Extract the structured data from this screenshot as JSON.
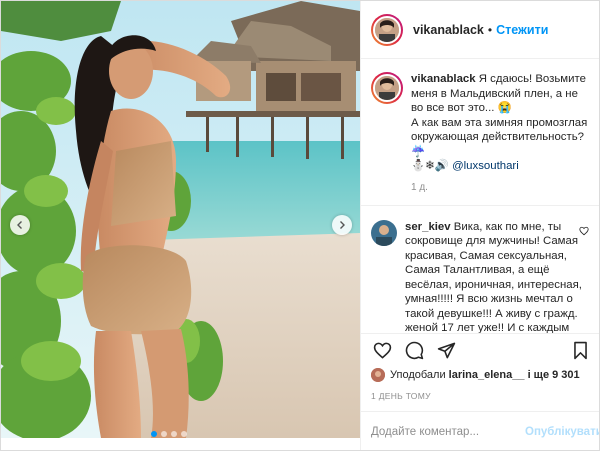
{
  "post": {
    "username": "vikanablack",
    "separator": "•",
    "follow_label": "Стежити",
    "caption": {
      "username": "vikanablack",
      "text_1": "Я сдаюсь! Возьмите меня в Мальдивский плен, а не во все вот это...",
      "emoji_1": "😭",
      "text_2": "А как вам эта зимняя промозглая окружающая действительность?",
      "emoji_2": "☔",
      "emoji_3": "⛄❄🔊",
      "mention": "@luxsouthari",
      "time": "1 д."
    },
    "reply": {
      "username": "ser_kiev",
      "text": "Вика, как по мне, ты сокровище для мужчины! Самая красивая, Самая сексуальная, Самая Талантливая, а ещё весёлая, ироничная, интересная, умная!!!!! Я всю жизнь мечтал о такой девушке!!! А живу с гражд. женой 17 лет уже!! И с каждым годом мне все более не о чем говорить с ней, неинтересно! Ты"
    },
    "likes": {
      "prefix": "Уподобали",
      "user": "larina_elena__",
      "suffix": "і ще 9 301"
    },
    "date": "1 ДЕНЬ ТОМУ",
    "comment_input": {
      "placeholder": "Додайте коментар..."
    },
    "publish_label": "Опублікувати"
  },
  "icons": {
    "like": "heart-icon",
    "comment": "comment-icon",
    "share": "share-icon",
    "save": "bookmark-icon",
    "prev": "chevron-left-icon",
    "next": "chevron-right-icon"
  },
  "colors": {
    "accent": "#0095f6",
    "publish_disabled": "#b2dffc",
    "muted": "#8e8e8e",
    "mention": "#00376b"
  },
  "carousel": {
    "dots": 4,
    "active_index": 0
  }
}
